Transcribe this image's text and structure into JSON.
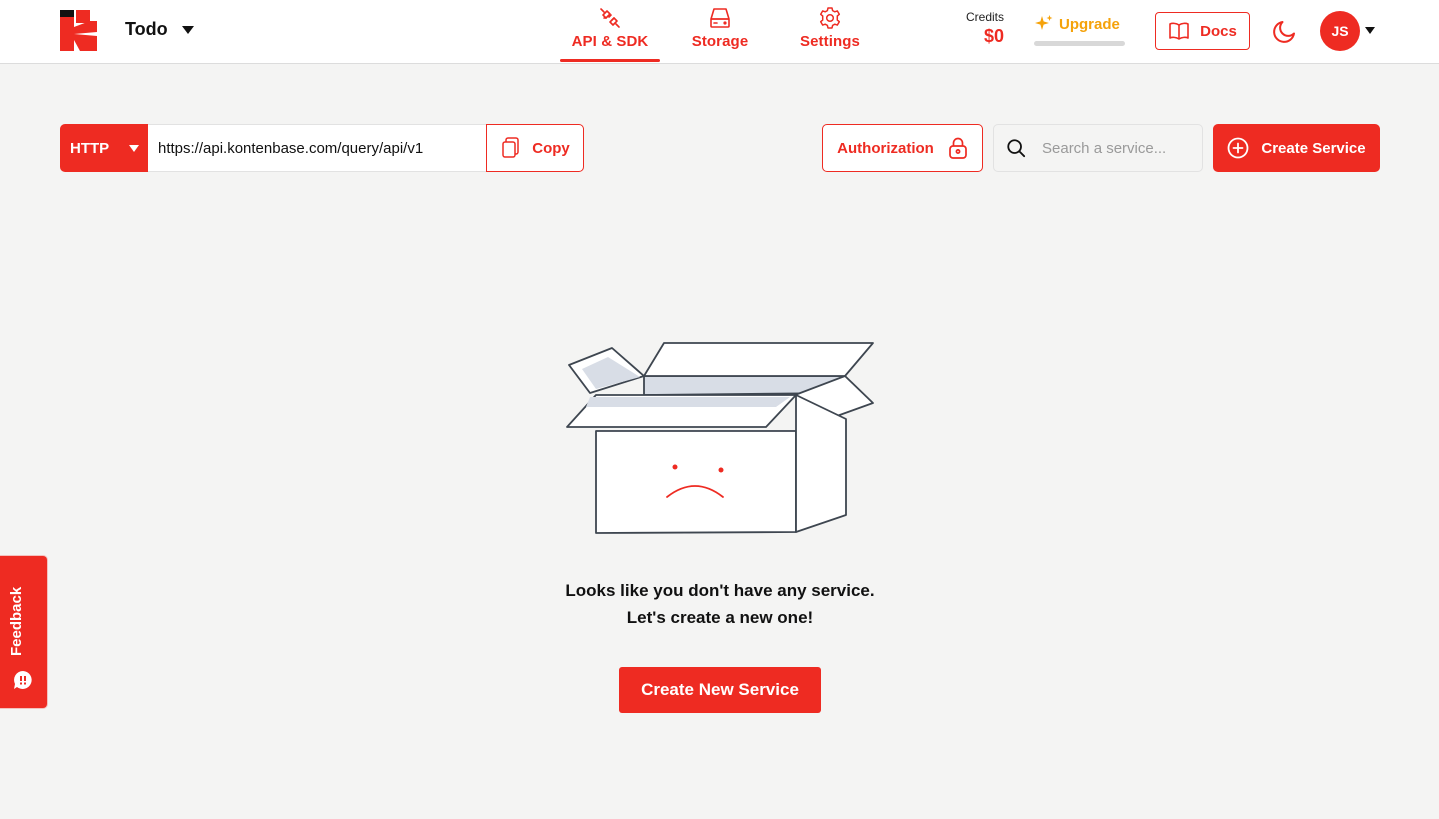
{
  "header": {
    "project_name": "Todo",
    "tabs": [
      {
        "label": "API & SDK",
        "icon": "plug-icon",
        "active": true
      },
      {
        "label": "Storage",
        "icon": "storage-drive-icon",
        "active": false
      },
      {
        "label": "Settings",
        "icon": "gear-icon",
        "active": false
      }
    ],
    "credits_label": "Credits",
    "credits_value": "$0",
    "upgrade_label": "Upgrade",
    "upgrade_progress": 0,
    "docs_label": "Docs",
    "avatar_initials": "JS"
  },
  "toolbar": {
    "protocol": "HTTP",
    "endpoint_url": "https://api.kontenbase.com/query/api/v1",
    "copy_label": "Copy",
    "authorization_label": "Authorization",
    "search_placeholder": "Search a service...",
    "create_service_label": "Create Service"
  },
  "empty_state": {
    "line1": "Looks like you don't have any service.",
    "line2": "Let's create a new one!",
    "button_label": "Create New Service"
  },
  "feedback": {
    "label": "Feedback"
  },
  "colors": {
    "accent": "#ee2b22",
    "upgrade": "#f5a20a",
    "background": "#f4f4f3"
  }
}
